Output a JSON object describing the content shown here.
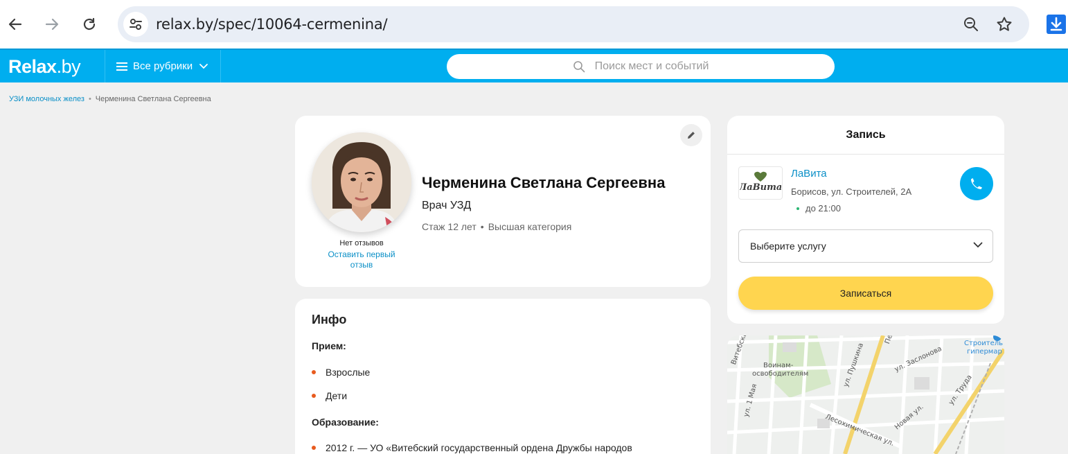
{
  "browser": {
    "url": "relax.by/spec/10064-cermenina/",
    "icons": [
      "back-arrow-icon",
      "forward-arrow-icon",
      "reload-icon",
      "site-info-icon",
      "zoom-out-icon",
      "bookmark-star-icon",
      "download-icon"
    ]
  },
  "header": {
    "logo": "Relax",
    "logo_suffix": ".by",
    "rubrics_label": "Все рубрики",
    "search_placeholder": "Поиск мест и событий",
    "accent_color": "#00aeef"
  },
  "breadcrumb": {
    "items": [
      "УЗИ молочных желез",
      "Черменина Светлана Сергеевна"
    ]
  },
  "profile": {
    "name": "Черменина Светлана Сергеевна",
    "specialty": "Врач УЗД",
    "experience": "Стаж 12 лет",
    "category": "Высшая категория",
    "no_reviews": "Нет отзывов",
    "leave_review": "Оставить первый отзыв"
  },
  "info": {
    "title": "Инфо",
    "reception_heading": "Прием:",
    "reception_items": [
      "Взрослые",
      "Дети"
    ],
    "education_heading": "Образование:",
    "education_items": [
      "2012 г. — УО «Витебский государственный ордена Дружбы народов"
    ]
  },
  "booking": {
    "title": "Запись",
    "clinic_name": "ЛаВита",
    "clinic_logo_text": "ЛаВита",
    "clinic_address": "Борисов, ул. Строителей, 2А",
    "clinic_hours": "до 21:00",
    "service_placeholder": "Выберите услугу",
    "book_button": "Записаться",
    "button_color": "#ffd54f"
  },
  "map": {
    "labels": [
      "Витебская ул.",
      "Воинам-",
      "освободителям",
      "ул. Пушкина",
      "ул. Заслонова",
      "Строитель",
      "гипермар",
      "ул. Труда",
      "ул. 1 Мая",
      "Новая ул.",
      "Лесохимическая ул.",
      "Пе"
    ]
  }
}
